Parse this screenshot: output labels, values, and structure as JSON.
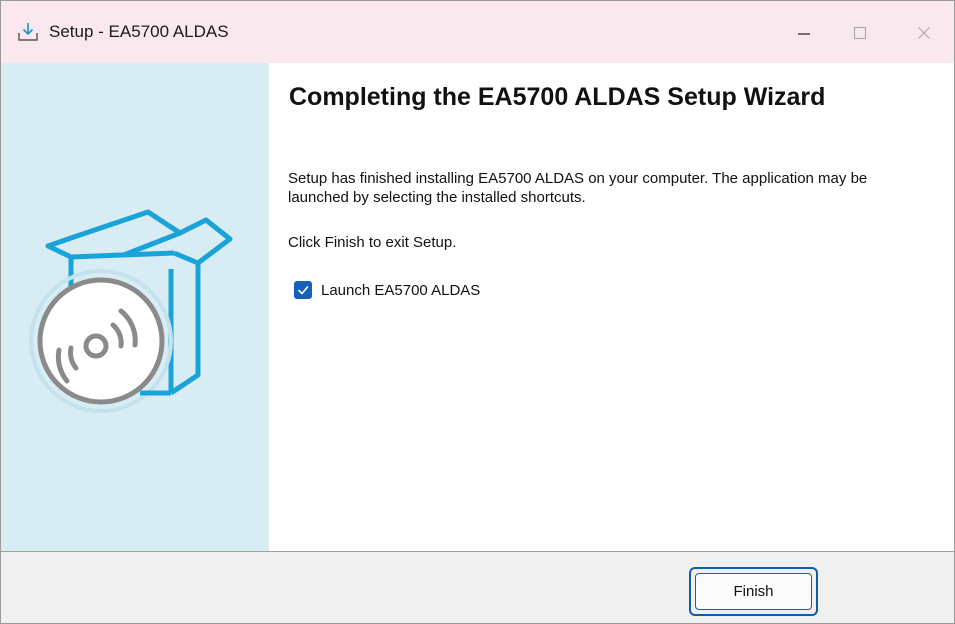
{
  "window": {
    "title": "Setup - EA5700 ALDAS",
    "title_icon": "download-install-icon",
    "controls": [
      "minimize-icon",
      "maximize-icon",
      "close-icon"
    ]
  },
  "banner": {
    "icon": "software-box-disc-icon",
    "colors": {
      "background": "#d8ecf4",
      "accent": "#1aa3d8",
      "disc": "#8a8a8a"
    }
  },
  "main": {
    "heading": "Completing the EA5700 ALDAS Setup Wizard",
    "message": "Setup has finished installing EA5700 ALDAS on your computer. The application may be launched by selecting the installed shortcuts.",
    "instruction": "Click Finish to exit Setup.",
    "launch_checkbox": {
      "label": "Launch EA5700 ALDAS",
      "checked": true
    }
  },
  "footer": {
    "finish_label": "Finish"
  },
  "colors": {
    "titlebar": "#f9e9ee",
    "checkbox": "#1660b8",
    "footer": "#f0f0f0",
    "focus_ring": "#0f5ea8"
  }
}
